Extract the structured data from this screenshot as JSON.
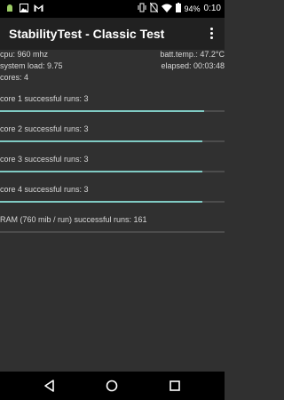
{
  "status_bar": {
    "battery": "94%",
    "time": "0:10",
    "left_icons": [
      "android-icon",
      "image-icon",
      "gmail-icon"
    ],
    "right_icons": [
      "vibrate-icon",
      "no-sim-icon",
      "wifi-icon",
      "battery-icon"
    ]
  },
  "app_bar": {
    "title": "StabilityTest - Classic Test",
    "menu_icon": "overflow-menu-icon"
  },
  "info": {
    "cpu": "cpu: 960 mhz",
    "batt_temp": "batt.temp.: 47.2°C",
    "system_load": "system load: 9.75",
    "elapsed": "elapsed: 00:03:48",
    "cores": "cores: 4"
  },
  "tests": [
    {
      "label": "core 1 successful runs: 3",
      "progress": 0.91
    },
    {
      "label": "core 2 successful runs: 3",
      "progress": 0.9
    },
    {
      "label": "core 3 successful runs: 3",
      "progress": 0.9
    },
    {
      "label": "core 4 successful runs: 3",
      "progress": 0.9
    },
    {
      "label": "RAM (760 mib / run) successful runs: 161",
      "progress": 0.0
    }
  ],
  "colors": {
    "accent": "#80cbc4",
    "background": "#303030",
    "appbar": "#212121"
  },
  "nav_bar": {
    "icons": [
      "back-icon",
      "home-icon",
      "recents-icon"
    ]
  }
}
